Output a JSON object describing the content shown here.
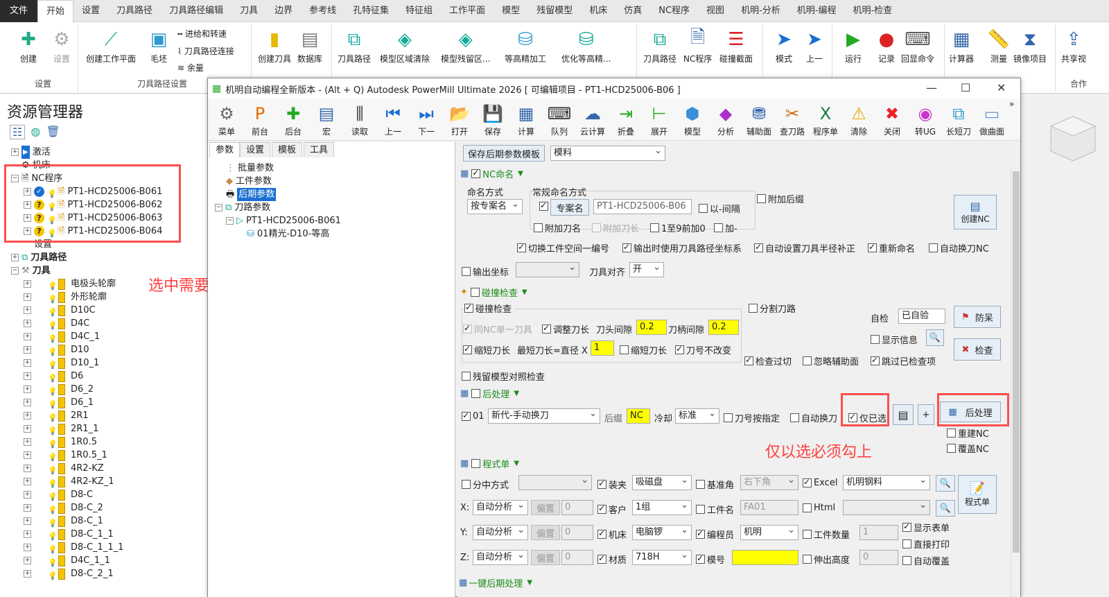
{
  "ribbon_tabs": [
    "文件",
    "开始",
    "设置",
    "刀具路径",
    "刀具路径编辑",
    "刀具",
    "边界",
    "参考线",
    "孔特征集",
    "特征组",
    "工作平面",
    "模型",
    "残留模型",
    "机床",
    "仿真",
    "NC程序",
    "视图",
    "机明-分析",
    "机明-编程",
    "机明-检查"
  ],
  "ribbon": {
    "create": "创建",
    "settings": "设置",
    "create_workplane": "创建工作平面",
    "blank": "毛坯",
    "feed_rate": "进给和转速",
    "toolpath_connect": "刀具路径连接",
    "allowance": "余量",
    "create_tool": "创建刀具",
    "database": "数据库",
    "toolpath": "刀具路径",
    "model_area_clear": "模型区域清除",
    "model_rest_area": "模型残留区...",
    "const_z_finish": "等高精加工",
    "opt_const_z": "优化等高精...",
    "toolpath2": "刀具路径",
    "nc_program": "NC程序",
    "collision_section": "碰撞截面",
    "mode": "模式",
    "prev": "上一",
    "run": "运行",
    "record": "记录",
    "echo_cmd": "回显命令",
    "calculator": "计算器",
    "measure": "测量",
    "mirror": "镜像项目",
    "share": "共享视",
    "group_settings": "设置",
    "group_toolpath_settings": "刀具路径设置",
    "group_merge": "合作"
  },
  "resource": {
    "title": "资源管理器",
    "items": {
      "activate": "激活",
      "machine": "机床",
      "nc_programs": "NC程序",
      "nc1": "PT1-HCD25006-B061",
      "nc2": "PT1-HCD25006-B062",
      "nc3": "PT1-HCD25006-B063",
      "nc4": "PT1-HCD25006-B064",
      "settings": "设置",
      "toolpaths": "刀具路径",
      "tools": "刀具"
    },
    "tools": [
      "电极头轮廓",
      "外形轮廓",
      "D10C",
      "D4C",
      "D4C_1",
      "D10",
      "D10_1",
      "D6",
      "D6_2",
      "D6_1",
      "2R1",
      "2R1_1",
      "1R0.5",
      "1R0.5_1",
      "4R2-KZ",
      "4R2-KZ_1",
      "D8-C",
      "D8-C_2",
      "D8-C_1",
      "D8-C_1_1",
      "D8-C_1_1_1",
      "D4C_1_1",
      "D8-C_2_1"
    ]
  },
  "annotations": {
    "select_nc": "选中需要处理的NC",
    "only_selected": "仅以选必须勾上"
  },
  "dialog": {
    "title": "机明自动编程全新版本 - (Alt + Q) Autodesk PowerMill Ultimate 2026   [ 可编辑项目 - PT1-HCD25006-B06 ]",
    "toolbar": [
      "菜单",
      "前台",
      "后台",
      "宏",
      "读取",
      "上一",
      "下一",
      "打开",
      "保存",
      "计算",
      "队列",
      "云计算",
      "折叠",
      "展开",
      "模型",
      "分析",
      "辅助面",
      "查刀路",
      "程序单",
      "清除",
      "关闭",
      "转UG",
      "长短刀",
      "做曲面"
    ],
    "left_tabs": [
      "参数",
      "设置",
      "模板",
      "工具"
    ],
    "tree": {
      "batch": "批量参数",
      "workpiece": "工件参数",
      "post": "后期参数",
      "toolpath_params": "刀路参数",
      "nc": "PT1-HCD25006-B061",
      "op": "01精光-D10-等高"
    },
    "save_template": "保存后期参数模板",
    "template_sel": "模料",
    "nc_naming": {
      "title": "NC命名",
      "method_label": "命名方式",
      "method": "按专案名",
      "regular_label": "常规命名方式",
      "project_btn": "专案名",
      "name_val": "PT1-HCD25006-B06",
      "dash_sep": "以-间隔",
      "append_suffix": "附加后缀",
      "append_tool": "附加刀名",
      "append_len": "附加刀长",
      "pad_zero": "1至9前加0",
      "add_dash": "加-",
      "create_nc": "创建NC",
      "switch_ws": "切换工件空间一编号",
      "use_coord": "输出时使用刀具路径坐标系",
      "auto_comp": "自动设置刀具半径补正",
      "rename": "重新命名",
      "auto_change": "自动换刀NC",
      "out_coord": "输出坐标",
      "tool_align": "刀具对齐",
      "tool_align_val": "开"
    },
    "collision": {
      "title": "碰撞检查",
      "check": "碰撞检查",
      "split": "分割刀路",
      "same_tool": "同NC单一刀具",
      "adjust_len": "调整刀长",
      "head_gap": "刀头间隙",
      "head_val": "0.2",
      "holder_gap": "刀柄间隙",
      "holder_val": "0.2",
      "shorten": "缩短刀长",
      "min_len": "最短刀长=直径 X",
      "min_val": "1",
      "shorten2": "缩短刀长",
      "keep_num": "刀号不改变",
      "self_check": "自检",
      "self_val": "已自验",
      "protect": "防呆",
      "show_info": "显示信息",
      "check_btn": "检查",
      "overcut": "检查过切",
      "ignore_aux": "忽略辅助面",
      "skip_checked": "跳过已检查项",
      "rest_model": "残留模型对照检查"
    },
    "post": {
      "title": "后处理",
      "idx": "01",
      "post_sel": "新代-手动换刀",
      "suffix_label": "后缀",
      "suffix": "NC",
      "coolant_label": "冷却",
      "coolant": "标准",
      "tool_num": "刀号按指定",
      "auto_tool": "自动换刀",
      "only_sel": "仅已选",
      "plus": "+",
      "post_btn": "后处理",
      "rebuild": "重建NC",
      "overwrite": "覆盖NC"
    },
    "sheet": {
      "title": "程式单",
      "center_mode": "分中方式",
      "clamp": "装夹",
      "clamp_val": "吸磁盘",
      "datum": "基准角",
      "datum_val": "右下角",
      "excel": "Excel",
      "excel_val": "机明钢料",
      "x_label": "X:",
      "y_label": "Y:",
      "z_label": "Z:",
      "auto": "自动分析",
      "offset": "偏置",
      "zero": "0",
      "customer": "客户",
      "customer_val": "1组",
      "workname": "工件名",
      "workname_val": "FA01",
      "html": "Html",
      "sheet_btn": "程式单",
      "machine": "机床",
      "machine_val": "电脑锣",
      "programmer": "编程员",
      "programmer_val": "机明",
      "qty": "工件数量",
      "qty_val": "1",
      "show_sheet": "显示表单",
      "direct_print": "直接打印",
      "material": "材质",
      "material_val": "718H",
      "mold_num": "模号",
      "ext_height": "伸出高度",
      "ext_val": "0",
      "auto_overwrite": "自动覆盖"
    },
    "one_key": "一键后期处理"
  }
}
